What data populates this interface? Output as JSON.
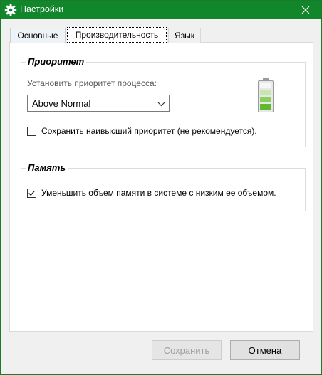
{
  "window": {
    "title": "Настройки",
    "title_icon": "gear-icon",
    "close_icon": "close-icon",
    "titlebar_color": "#11862a"
  },
  "tabs": [
    {
      "label": "Основные",
      "active": false
    },
    {
      "label": "Производительность",
      "active": true
    },
    {
      "label": "Язык",
      "active": false
    }
  ],
  "priority": {
    "group_title": "Приоритет",
    "label": "Установить приоритет процесса:",
    "selected": "Above Normal",
    "battery_icon": "battery-icon",
    "keep_highest_label": "Сохранить наивысший приоритет (не рекомендуется).",
    "keep_highest_checked": false
  },
  "memory": {
    "group_title": "Память",
    "reduce_label": "Уменьшить объем памяти в системе с низким ее объемом.",
    "reduce_checked": true
  },
  "buttons": {
    "save_label": "Сохранить",
    "save_enabled": false,
    "cancel_label": "Отмена"
  }
}
